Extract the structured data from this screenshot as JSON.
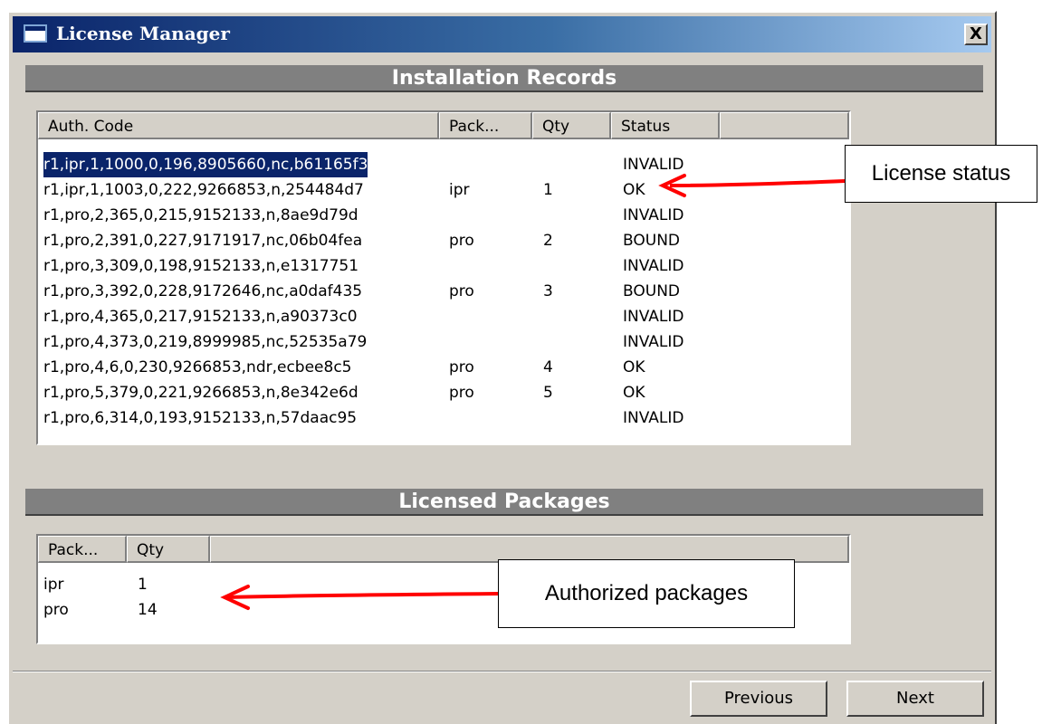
{
  "window": {
    "title": "License Manager",
    "close_label": "X"
  },
  "installation_records": {
    "section_title": "Installation Records",
    "columns": [
      "Auth. Code",
      "Pack...",
      "Qty",
      "Status"
    ],
    "rows": [
      {
        "auth": "r1,ipr,1,1000,0,196,8905660,nc,b61165f3",
        "pack": "",
        "qty": "",
        "status": "INVALID"
      },
      {
        "auth": "r1,ipr,1,1003,0,222,9266853,n,254484d7",
        "pack": "ipr",
        "qty": "1",
        "status": "OK"
      },
      {
        "auth": "r1,pro,2,365,0,215,9152133,n,8ae9d79d",
        "pack": "",
        "qty": "",
        "status": "INVALID"
      },
      {
        "auth": "r1,pro,2,391,0,227,9171917,nc,06b04fea",
        "pack": "pro",
        "qty": "2",
        "status": "BOUND"
      },
      {
        "auth": "r1,pro,3,309,0,198,9152133,n,e1317751",
        "pack": "",
        "qty": "",
        "status": "INVALID"
      },
      {
        "auth": "r1,pro,3,392,0,228,9172646,nc,a0daf435",
        "pack": "pro",
        "qty": "3",
        "status": "BOUND"
      },
      {
        "auth": "r1,pro,4,365,0,217,9152133,n,a90373c0",
        "pack": "",
        "qty": "",
        "status": "INVALID"
      },
      {
        "auth": "r1,pro,4,373,0,219,8999985,nc,52535a79",
        "pack": "",
        "qty": "",
        "status": "INVALID"
      },
      {
        "auth": "r1,pro,4,6,0,230,9266853,ndr,ecbee8c5",
        "pack": "pro",
        "qty": "4",
        "status": "OK"
      },
      {
        "auth": "r1,pro,5,379,0,221,9266853,n,8e342e6d",
        "pack": "pro",
        "qty": "5",
        "status": "OK"
      },
      {
        "auth": "r1,pro,6,314,0,193,9152133,n,57daac95",
        "pack": "",
        "qty": "",
        "status": "INVALID"
      }
    ]
  },
  "licensed_packages": {
    "section_title": "Licensed Packages",
    "columns": [
      "Pack...",
      "Qty"
    ],
    "rows": [
      {
        "pack": "ipr",
        "qty": "1"
      },
      {
        "pack": "pro",
        "qty": "14"
      }
    ]
  },
  "buttons": {
    "previous": "Previous",
    "next": "Next"
  },
  "annotations": {
    "license_status": "License status",
    "authorized_packages": "Authorized packages",
    "arrow_color": "#ff0000"
  }
}
